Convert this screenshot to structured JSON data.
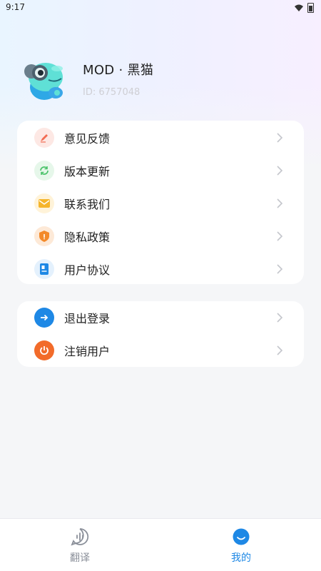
{
  "status_bar": {
    "time": "9:17",
    "icons": [
      "wifi-icon",
      "battery-icon"
    ]
  },
  "profile": {
    "name": "MOD · 黑猫",
    "user_id": "ID: 6757048",
    "avatar": "chameleon-mascot"
  },
  "menu_group_1": [
    {
      "label": "意见反馈",
      "icon": "feedback-icon",
      "icon_color": "#f26b52",
      "icon_bg": "#fde8e4"
    },
    {
      "label": "版本更新",
      "icon": "refresh-icon",
      "icon_color": "#4cc36b",
      "icon_bg": "#e6f7ea"
    },
    {
      "label": "联系我们",
      "icon": "mail-icon",
      "icon_color": "#f5b52b",
      "icon_bg": "#fff3d9"
    },
    {
      "label": "隐私政策",
      "icon": "shield-icon",
      "icon_color": "#f38a2a",
      "icon_bg": "#fde9d7"
    },
    {
      "label": "用户协议",
      "icon": "document-icon",
      "icon_color": "#1e88e5",
      "icon_bg": "#e4f1fd"
    }
  ],
  "menu_group_2": [
    {
      "label": "退出登录",
      "icon": "logout-arrow-icon",
      "icon_color": "#ffffff",
      "icon_bg": "#1e88e5"
    },
    {
      "label": "注销用户",
      "icon": "power-icon",
      "icon_color": "#ffffff",
      "icon_bg": "#f26b2a"
    }
  ],
  "bottom_nav": {
    "items": [
      {
        "label": "翻译",
        "icon": "voice-translate-icon",
        "active": false
      },
      {
        "label": "我的",
        "icon": "profile-face-icon",
        "active": true
      }
    ],
    "active_color": "#1e88e5",
    "inactive_color": "#8a8f99"
  }
}
